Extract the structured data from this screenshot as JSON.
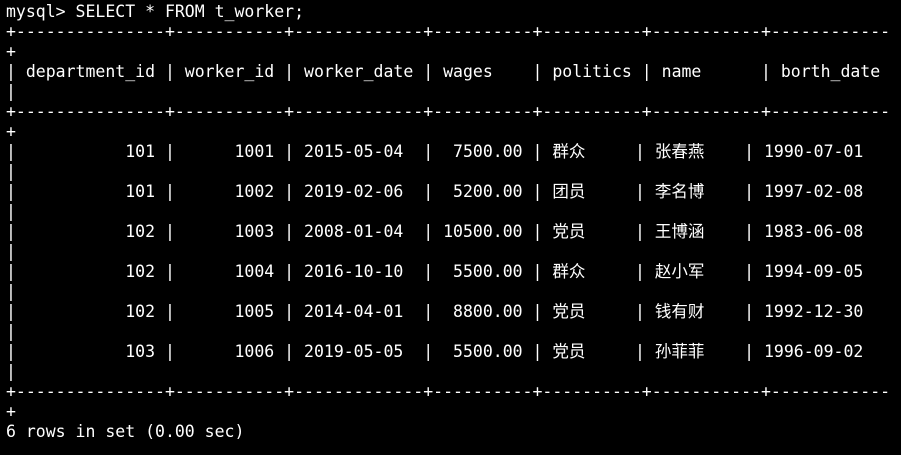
{
  "terminal": {
    "command_line": "mysql> SELECT * FROM t_worker;",
    "border_line": "+---------------+-----------+-------------+----------+----------+-----------+------------",
    "wrap_plus": "+",
    "wrap_pipe": "|",
    "header_line": "| department_id | worker_id | worker_date | wages    | politics | name      | borth_date",
    "rows": [
      {
        "line": "|           101 |      1001 | 2015-05-04  |  7500.00 | 群众     | 张春燕    | 1990-07-01"
      },
      {
        "line": "|           101 |      1002 | 2019-02-06  |  5200.00 | 团员     | 李名博    | 1997-02-08"
      },
      {
        "line": "|           102 |      1003 | 2008-01-04  | 10500.00 | 党员     | 王博涵    | 1983-06-08"
      },
      {
        "line": "|           102 |      1004 | 2016-10-10  |  5500.00 | 群众     | 赵小军    | 1994-09-05"
      },
      {
        "line": "|           102 |      1005 | 2014-04-01  |  8800.00 | 党员     | 钱有财    | 1992-12-30"
      },
      {
        "line": "|           103 |      1006 | 2019-05-05  |  5500.00 | 党员     | 孙菲菲    | 1996-09-02"
      }
    ],
    "result_line": "6 rows in set (0.00 sec)"
  }
}
